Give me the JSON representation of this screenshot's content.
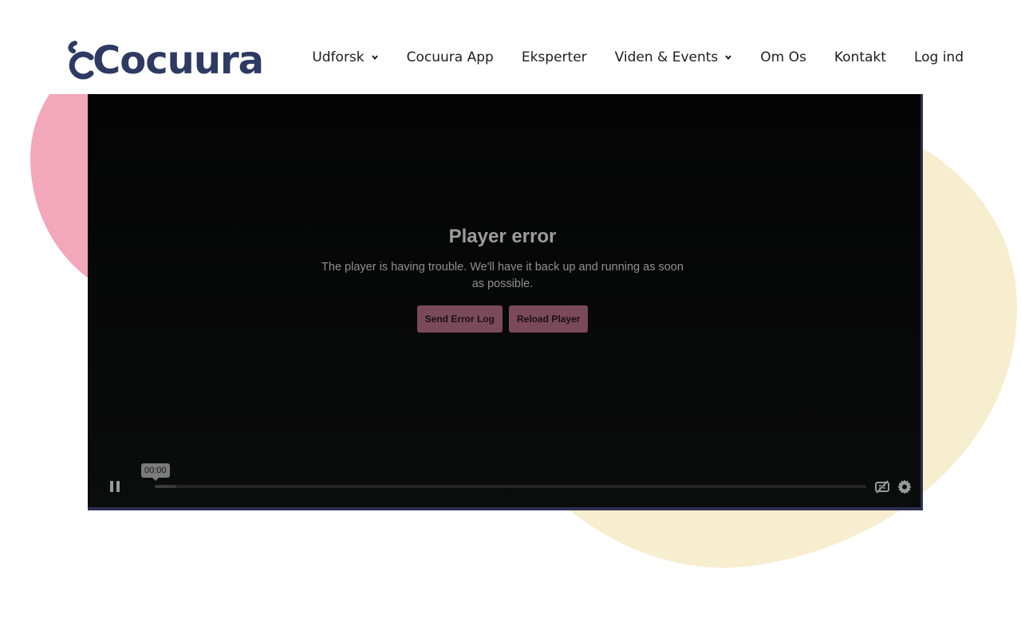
{
  "brand": {
    "logo_text": "Cocuura"
  },
  "nav": {
    "udforsk": "Udforsk",
    "app": "Cocuura App",
    "eksperter": "Eksperter",
    "viden": "Viden & Events",
    "om": "Om Os",
    "kontakt": "Kontakt",
    "login": "Log ind"
  },
  "player": {
    "error_title": "Player error",
    "error_message": "The player is having trouble. We'll have it back up and running as soon as possible.",
    "send_log_label": "Send Error Log",
    "reload_label": "Reload Player",
    "time": "00:00",
    "progress": 0.03,
    "accent_color": "#7a4a5a"
  },
  "colors": {
    "brand": "#2e3a62",
    "blob_pink": "#f2a7bb",
    "blob_yellow": "#f7edcf"
  },
  "icons": {
    "pause": "pause-icon",
    "captions_off": "captions-off-icon",
    "settings": "gear-icon",
    "dropdown": "chevron-down-icon"
  }
}
